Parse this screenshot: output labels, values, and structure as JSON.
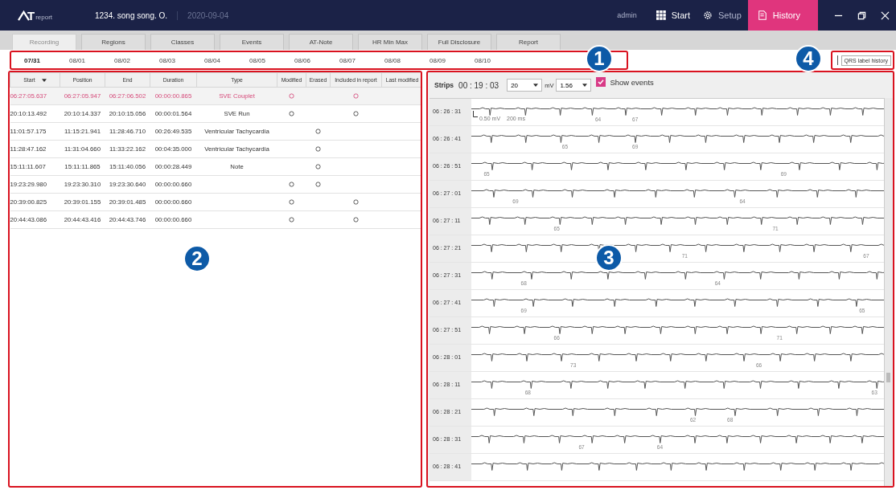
{
  "header": {
    "logo_letter": "T",
    "logo_sub": "report",
    "patient": "1234. song song. O.",
    "date": "2020-09-04",
    "user": "admin",
    "nav": [
      {
        "label": "Start",
        "selected": false
      },
      {
        "label": "Setup",
        "selected": false
      },
      {
        "label": "History",
        "selected": true
      }
    ]
  },
  "tabs": [
    {
      "label": "Recording",
      "selected": true
    },
    {
      "label": "Regions",
      "selected": false
    },
    {
      "label": "Classes",
      "selected": false
    },
    {
      "label": "Events",
      "selected": false
    },
    {
      "label": "AT-Note",
      "selected": false
    },
    {
      "label": "HR Min Max",
      "selected": false
    },
    {
      "label": "Full Disclosure",
      "selected": false
    },
    {
      "label": "Report",
      "selected": false
    }
  ],
  "dates": [
    {
      "label": "07/31",
      "selected": true
    },
    {
      "label": "08/01",
      "selected": false
    },
    {
      "label": "08/02",
      "selected": false
    },
    {
      "label": "08/03",
      "selected": false
    },
    {
      "label": "08/04",
      "selected": false
    },
    {
      "label": "08/05",
      "selected": false
    },
    {
      "label": "08/06",
      "selected": false
    },
    {
      "label": "08/07",
      "selected": false
    },
    {
      "label": "08/08",
      "selected": false
    },
    {
      "label": "08/09",
      "selected": false
    },
    {
      "label": "08/10",
      "selected": false
    }
  ],
  "qrs_button": "QRS label history",
  "table": {
    "columns": [
      "Start",
      "Position",
      "End",
      "Duration",
      "Type",
      "Modified",
      "Erased",
      "Included in report",
      "Last modified"
    ],
    "rows": [
      {
        "start": "06:27:05.637",
        "position": "06:27:05.947",
        "end": "06:27:06.502",
        "duration": "00:00:00.865",
        "type": "SVE Couplet",
        "modified": true,
        "erased": false,
        "included": true,
        "selected": true
      },
      {
        "start": "20:10:13.492",
        "position": "20:10:14.337",
        "end": "20:10:15.056",
        "duration": "00:00:01.564",
        "type": "SVE Run",
        "modified": true,
        "erased": false,
        "included": true,
        "selected": false
      },
      {
        "start": "11:01:57.175",
        "position": "11:15:21.941",
        "end": "11:28:46.710",
        "duration": "00:26:49.535",
        "type": "Ventricular Tachycardia",
        "modified": false,
        "erased": true,
        "included": false,
        "selected": false
      },
      {
        "start": "11:28:47.162",
        "position": "11:31:04.660",
        "end": "11:33:22.162",
        "duration": "00:04:35.000",
        "type": "Ventricular Tachycardia",
        "modified": false,
        "erased": true,
        "included": false,
        "selected": false
      },
      {
        "start": "15:11:11.607",
        "position": "15:11:11.865",
        "end": "15:11:40.056",
        "duration": "00:00:28.449",
        "type": "Note",
        "modified": false,
        "erased": true,
        "included": false,
        "selected": false
      },
      {
        "start": "19:23:29.980",
        "position": "19:23:30.310",
        "end": "19:23:30.640",
        "duration": "00:00:00.660",
        "modified": true,
        "erased": true,
        "included": false,
        "selected": false
      },
      {
        "start": "20:39:00.825",
        "position": "20:39:01.155",
        "end": "20:39:01.485",
        "duration": "00:00:00.660",
        "modified": true,
        "erased": false,
        "included": true,
        "selected": false
      },
      {
        "start": "20:44:43.086",
        "position": "20:44:43.416",
        "end": "20:44:43.746",
        "duration": "00:00:00.660",
        "modified": true,
        "erased": false,
        "included": true,
        "selected": false
      }
    ]
  },
  "strips": {
    "label": "Strips",
    "time": "00 : 19 : 03",
    "speed": "20",
    "unit": "mV",
    "gain": "1.56",
    "show_events": {
      "label": "Show events",
      "checked": true
    },
    "scale": {
      "amplitude": "0.50 mV",
      "duration": "200 ms"
    },
    "rows": [
      {
        "time": "06 : 26 : 31",
        "hr": [
          "64",
          "67"
        ]
      },
      {
        "time": "06 : 26 : 41",
        "hr": [
          "65",
          "69"
        ]
      },
      {
        "time": "06 : 26 : 51",
        "hr": [
          "65",
          "69"
        ]
      },
      {
        "time": "06 : 27 : 01",
        "hr": [
          "69",
          "64"
        ]
      },
      {
        "time": "06 : 27 : 11",
        "hr": [
          "65",
          "71"
        ]
      },
      {
        "time": "06 : 27 : 21",
        "hr": [
          "71",
          "67"
        ]
      },
      {
        "time": "06 : 27 : 31",
        "hr": [
          "68",
          "64"
        ]
      },
      {
        "time": "06 : 27 : 41",
        "hr": [
          "69",
          "65"
        ]
      },
      {
        "time": "06 : 27 : 51",
        "hr": [
          "66",
          "71"
        ]
      },
      {
        "time": "06 : 28 : 01",
        "hr": [
          "73",
          "66"
        ]
      },
      {
        "time": "06 : 28 : 11",
        "hr": [
          "68",
          "63"
        ]
      },
      {
        "time": "06 : 28 : 21",
        "hr": [
          "62",
          "68"
        ]
      },
      {
        "time": "06 : 28 : 31",
        "hr": [
          "67",
          "64"
        ]
      },
      {
        "time": "06 : 28 : 41",
        "hr": []
      }
    ]
  },
  "callouts": [
    {
      "label": "1"
    },
    {
      "label": "4"
    },
    {
      "label": "2"
    },
    {
      "label": "3"
    }
  ]
}
